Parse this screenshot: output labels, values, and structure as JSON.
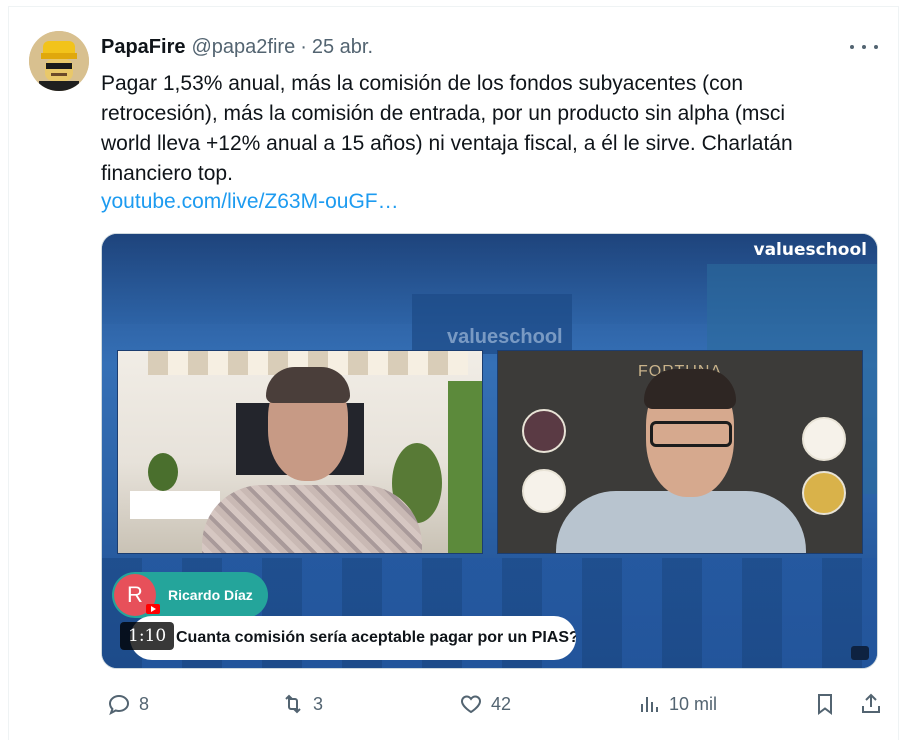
{
  "tweet": {
    "author_name": "PapaFire",
    "handle": "@papa2fire",
    "separator": "·",
    "time": "25 abr.",
    "text_lines": [
      "Pagar 1,53% anual, más la comisión de los fondos subyacentes (con",
      "retrocesión), más la comisión de entrada, por un producto sin alpha (msci",
      "world lleva +12% anual a 15 años) ni ventaja fiscal, a él le sirve. Charlatán",
      "financiero top."
    ],
    "link": "youtube.com/live/Z63M-ouGF…"
  },
  "media": {
    "brand_logo": "valueschool",
    "brand_logo_background": "valueschool",
    "sponsor_logo": "FORTUNA",
    "speaker_initial": "R",
    "speaker_name": "Ricardo Díaz",
    "question": "Cuanta comisión sería aceptable pagar por un PIAS?",
    "duration": "1:10"
  },
  "actions": {
    "replies": "8",
    "retweets": "3",
    "likes": "42",
    "views": "10 mil"
  },
  "colors": {
    "link": "#1d9bf0",
    "muted": "#536471",
    "speaker_pill": "#24a59b"
  },
  "icons": [
    "more-icon",
    "reply-icon",
    "retweet-icon",
    "like-icon",
    "views-icon",
    "bookmark-icon",
    "share-icon",
    "youtube-icon"
  ]
}
